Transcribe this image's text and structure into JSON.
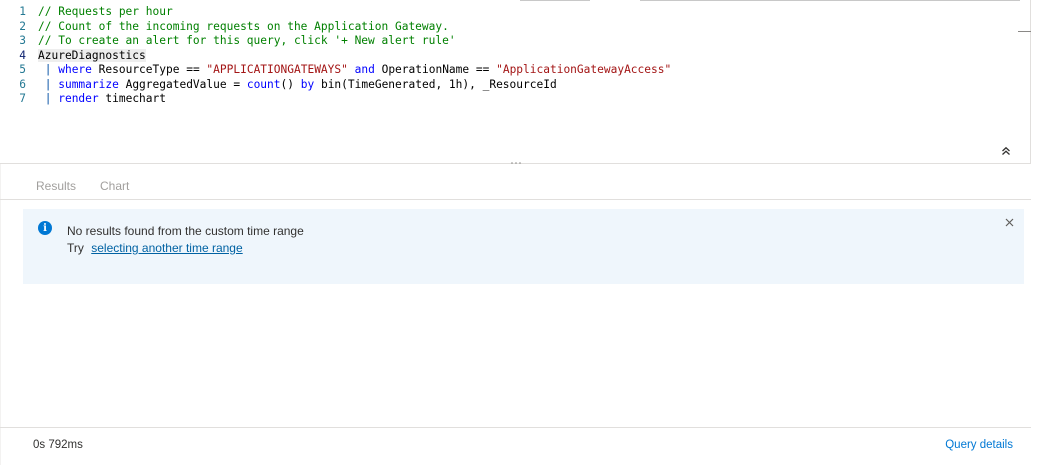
{
  "editor": {
    "lines": [
      {
        "num": "1",
        "tokens": [
          {
            "t": "// Requests per hour",
            "c": "comment"
          }
        ]
      },
      {
        "num": "2",
        "tokens": [
          {
            "t": "// Count of the incoming requests on the Application Gateway.",
            "c": "comment"
          }
        ]
      },
      {
        "num": "3",
        "tokens": [
          {
            "t": "// To create an alert for this query, click '+ New alert rule'",
            "c": "comment"
          }
        ]
      },
      {
        "num": "4",
        "current": true,
        "tokens": [
          {
            "t": "AzureDiagnostics",
            "c": "plain",
            "hl": true
          }
        ]
      },
      {
        "num": "5",
        "tokens": [
          {
            "t": " | ",
            "c": "pipe"
          },
          {
            "t": "where",
            "c": "kw"
          },
          {
            "t": " ResourceType == ",
            "c": "plain"
          },
          {
            "t": "\"APPLICATIONGATEWAYS\"",
            "c": "str"
          },
          {
            "t": " ",
            "c": "plain"
          },
          {
            "t": "and",
            "c": "kw"
          },
          {
            "t": " OperationName == ",
            "c": "plain"
          },
          {
            "t": "\"ApplicationGatewayAccess\"",
            "c": "str"
          }
        ]
      },
      {
        "num": "6",
        "tokens": [
          {
            "t": " | ",
            "c": "pipe"
          },
          {
            "t": "summarize",
            "c": "kw"
          },
          {
            "t": " AggregatedValue = ",
            "c": "plain"
          },
          {
            "t": "count",
            "c": "kw"
          },
          {
            "t": "() ",
            "c": "plain"
          },
          {
            "t": "by",
            "c": "kw"
          },
          {
            "t": " bin(TimeGenerated, 1h), _ResourceId",
            "c": "plain"
          }
        ]
      },
      {
        "num": "7",
        "tokens": [
          {
            "t": " | ",
            "c": "pipe"
          },
          {
            "t": "render",
            "c": "kw"
          },
          {
            "t": " timechart",
            "c": "plain"
          }
        ]
      }
    ]
  },
  "tabs": [
    {
      "label": "Results"
    },
    {
      "label": "Chart"
    }
  ],
  "infobar": {
    "title": "No results found from the custom time range",
    "prefix": "Try",
    "link": "selecting another time range"
  },
  "footer": {
    "status": "0s 792ms",
    "query_details": "Query details"
  },
  "colors": {
    "comment": "#008000",
    "keyword": "#0000ff",
    "string": "#a31515",
    "accent": "#0078d4",
    "infobar_bg": "#eff6fc"
  }
}
